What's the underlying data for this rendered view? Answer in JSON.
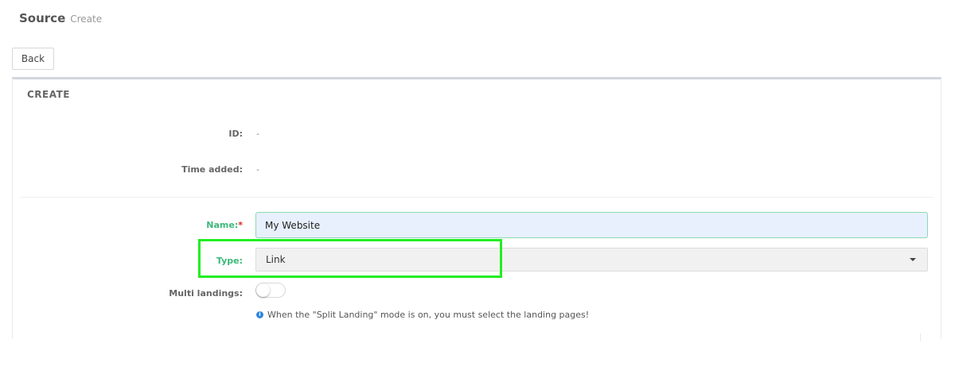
{
  "header": {
    "title": "Source",
    "subtitle": "Create"
  },
  "toolbar": {
    "back_label": "Back"
  },
  "panel": {
    "title": "CREATE",
    "info_fields": [
      {
        "label": "ID:",
        "value": "-"
      },
      {
        "label": "Time added:",
        "value": "-"
      }
    ],
    "form": {
      "name_label": "Name:",
      "name_required_mark": "*",
      "name_value": "My Website",
      "type_label": "Type:",
      "type_value": "Link",
      "multi_landings_label": "Multi landings:",
      "multi_landings_on": false,
      "info_icon_glyph": "i",
      "info_note": "When the \"Split Landing\" mode is on, you must select the landing pages!"
    }
  },
  "colors": {
    "accent_green": "#3cb97a",
    "required_red": "#dd2222",
    "input_bg": "#e8f0fd",
    "highlight": "#22ee22",
    "info_blue": "#2e86de"
  },
  "icons": {
    "select_caret": "chevron-down-icon",
    "info": "info-icon"
  }
}
